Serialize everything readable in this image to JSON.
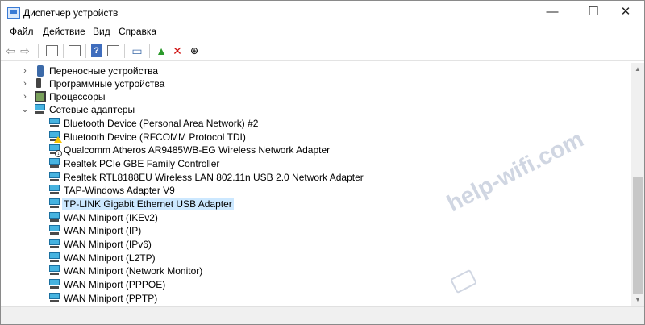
{
  "window": {
    "title": "Диспетчер устройств",
    "controls": {
      "minimize": "—",
      "maximize": "☐",
      "close": "✕"
    }
  },
  "menu": [
    "Файл",
    "Действие",
    "Вид",
    "Справка"
  ],
  "toolbar": {
    "icons": [
      "back-icon",
      "forward-icon",
      "properties-icon",
      "show-hidden-icon",
      "help-icon",
      "view-icon",
      "monitor-scan-icon",
      "update-driver-icon",
      "uninstall-icon",
      "download-icon"
    ]
  },
  "tree": {
    "rows": [
      {
        "label": "Переносные устройства",
        "level": 1,
        "chevron": "›",
        "icon": "portable-device-icon"
      },
      {
        "label": "Программные устройства",
        "level": 1,
        "chevron": "›",
        "icon": "software-device-icon"
      },
      {
        "label": "Процессоры",
        "level": 1,
        "chevron": "›",
        "icon": "processor-icon"
      },
      {
        "label": "Сетевые адаптеры",
        "level": 1,
        "chevron": "⌄",
        "icon": "network-adapter-icon"
      },
      {
        "label": "Bluetooth Device (Personal Area Network) #2",
        "level": 2,
        "icon": "network-adapter-icon"
      },
      {
        "label": "Bluetooth Device (RFCOMM Protocol TDI)",
        "level": 2,
        "icon": "network-adapter-warning-icon"
      },
      {
        "label": "Qualcomm Atheros AR9485WB-EG Wireless Network Adapter",
        "level": 2,
        "icon": "network-adapter-disabled-icon"
      },
      {
        "label": "Realtek PCIe GBE Family Controller",
        "level": 2,
        "icon": "network-adapter-icon"
      },
      {
        "label": "Realtek RTL8188EU Wireless LAN 802.11n USB 2.0 Network Adapter",
        "level": 2,
        "icon": "network-adapter-icon"
      },
      {
        "label": "TAP-Windows Adapter V9",
        "level": 2,
        "icon": "network-adapter-icon"
      },
      {
        "label": "TP-LINK Gigabit Ethernet USB Adapter",
        "level": 2,
        "icon": "network-adapter-icon",
        "selected": true
      },
      {
        "label": "WAN Miniport (IKEv2)",
        "level": 2,
        "icon": "network-adapter-icon"
      },
      {
        "label": "WAN Miniport (IP)",
        "level": 2,
        "icon": "network-adapter-icon"
      },
      {
        "label": "WAN Miniport (IPv6)",
        "level": 2,
        "icon": "network-adapter-icon"
      },
      {
        "label": "WAN Miniport (L2TP)",
        "level": 2,
        "icon": "network-adapter-icon"
      },
      {
        "label": "WAN Miniport (Network Monitor)",
        "level": 2,
        "icon": "network-adapter-icon"
      },
      {
        "label": "WAN Miniport (PPPOE)",
        "level": 2,
        "icon": "network-adapter-icon"
      },
      {
        "label": "WAN Miniport (PPTP)",
        "level": 2,
        "icon": "network-adapter-icon"
      }
    ]
  },
  "watermark": "help-wifi.com",
  "colors": {
    "selection": "#cce8ff",
    "accent": "#46b3e0"
  }
}
